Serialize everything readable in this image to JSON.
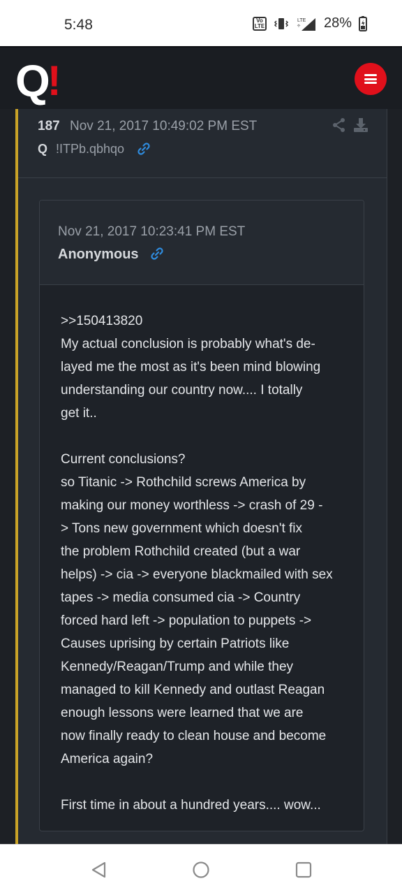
{
  "status_bar": {
    "time": "5:48",
    "volte_icon": "volte-icon",
    "vibrate_icon": "vibrate-icon",
    "signal_icon": "lte-signal-icon",
    "battery_percent": "28%",
    "battery_icon": "battery-charging-icon"
  },
  "header": {
    "logo_q": "Q",
    "logo_bang": "!",
    "menu_icon": "hamburger-menu-icon",
    "brand_color": "#e0101b"
  },
  "post": {
    "number": "187",
    "datetime": "Nov 21, 2017 10:49:02 PM EST",
    "author_label": "Q",
    "tripcode": "!ITPb.qbhqo",
    "link_icon": "link-icon",
    "share_icon": "share-icon",
    "download_icon": "download-icon",
    "accent_color": "#c9a227"
  },
  "quoted": {
    "datetime": "Nov 21, 2017 10:23:41 PM EST",
    "author": "Anonymous",
    "link_icon": "link-icon",
    "body": ">>150413820\nMy actual conclusion is probably what's de-\nlayed me the most as it's been mind blowing\nunderstanding our country now.... I totally\nget it..\n\nCurrent conclusions?\nso Titanic -> Rothchild screws America by\nmaking our money worthless -> crash of 29 -\n> Tons new government which doesn't fix\nthe problem Rothchild created (but a war\nhelps) -> cia -> everyone blackmailed with sex\ntapes -> media consumed cia -> Country\nforced hard left -> population to puppets ->\nCauses uprising by certain Patriots like\nKennedy/Reagan/Trump and while they\nmanaged to kill Kennedy and outlast Reagan\nenough lessons were learned that we are\nnow finally ready to clean house and become\nAmerica again?\n\nFirst time in about a hundred years.... wow..."
  },
  "nav_bar": {
    "back_icon": "back-triangle-icon",
    "home_icon": "home-circle-icon",
    "recents_icon": "recents-square-icon"
  }
}
